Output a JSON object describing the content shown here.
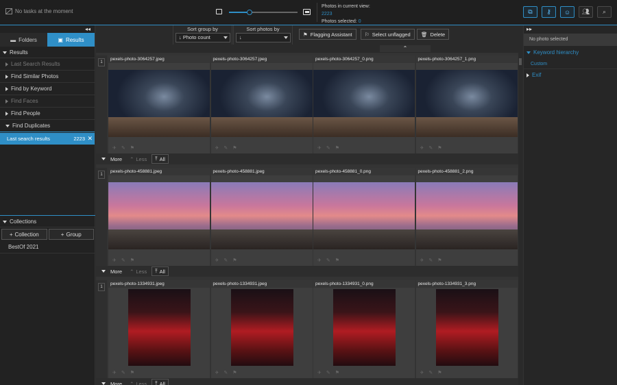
{
  "topbar": {
    "task_text": "No tasks at the moment",
    "zoom_level": 0.3,
    "counts_view_label": "Photos in current view:",
    "counts_view_value": "2223",
    "counts_selected_label": "Photos selected:",
    "counts_selected_value": "0"
  },
  "left": {
    "tab_folders": "Folders",
    "tab_results": "Results",
    "results_header": "Results",
    "items": [
      "Last Search Results",
      "Find Similar Photos",
      "Find by Keyword",
      "Find Faces",
      "Find People",
      "Find Duplicates"
    ],
    "result_label": "Last search results",
    "result_count": "2223",
    "collections_header": "Collections",
    "add_collection": "Collection",
    "add_group": "Group",
    "collection_item": "BestOf 2021"
  },
  "toolbar": {
    "sort_group_label": "Sort group by",
    "sort_group_value": "Photo count",
    "sort_photos_label": "Sort photos by",
    "sort_photos_value": "",
    "flagging": "Flagging Assistant",
    "select_unflagged": "Select unflagged",
    "delete": "Delete"
  },
  "groups": [
    {
      "number": "1",
      "files": [
        "pexels-photo-3064257.jpeg",
        "pexels-photo-3064257.jpeg",
        "pexels-photo-3064257_0.png",
        "pexels-photo-3064257_1.png"
      ]
    },
    {
      "number": "1",
      "files": [
        "pexels-photo-458881.jpeg",
        "pexels-photo-458881.jpeg",
        "pexels-photo-458881_0.png",
        "pexels-photo-458881_2.png"
      ]
    },
    {
      "number": "1",
      "files": [
        "pexels-photo-1334931.jpeg",
        "pexels-photo-1334931.jpeg",
        "pexels-photo-1334931_0.png",
        "pexels-photo-1334931_3.png"
      ]
    }
  ],
  "group_footer": {
    "more": "More",
    "less": "Less",
    "all": "All"
  },
  "right": {
    "no_photo": "No photo selected",
    "keyword_hierarchy": "Keyword hierarchy",
    "keyword_item": "Custom",
    "exif": "Exif"
  },
  "colors": {
    "accent": "#2f8fc7"
  }
}
